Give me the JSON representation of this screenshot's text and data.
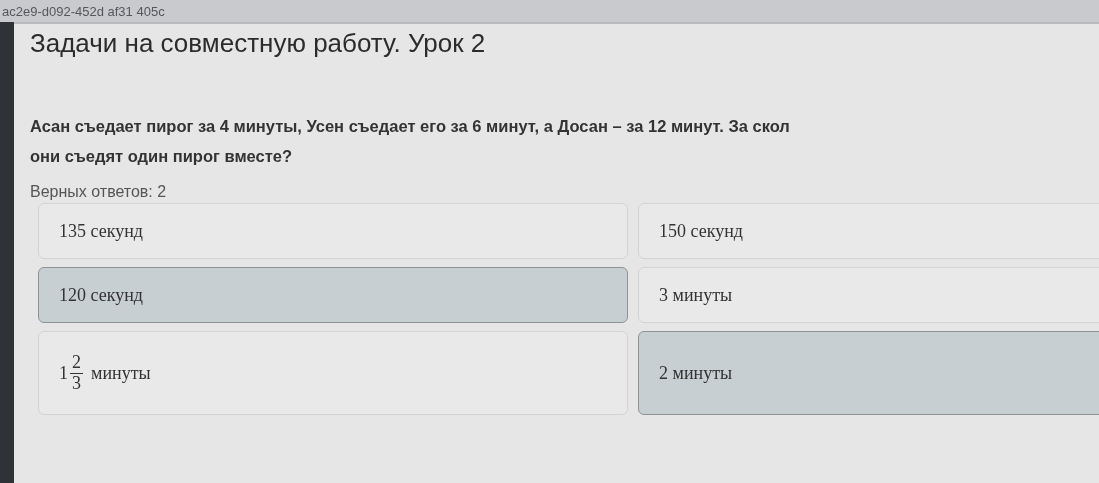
{
  "top_strip": {
    "text": "ac2e9-d092-452d af31 405c"
  },
  "lesson": {
    "title": "Задачи на совместную работу. Урок 2"
  },
  "question": {
    "lines": [
      "Асан съедает пирог за 4 минуты, Усен съедает его за 6 минут, а Досан – за 12 минут. За скол",
      "они съедят один пирог вместе?"
    ]
  },
  "answers_hint": "Верных ответов: 2",
  "options": [
    {
      "kind": "text",
      "text": "135 секунд",
      "selected": false
    },
    {
      "kind": "text",
      "text": "150 секунд",
      "selected": false
    },
    {
      "kind": "text",
      "text": "120 секунд",
      "selected": true
    },
    {
      "kind": "text",
      "text": "3 минуты",
      "selected": false
    },
    {
      "kind": "fraction",
      "whole": "1",
      "numerator": "2",
      "denominator": "3",
      "unit": "минуты",
      "selected": false
    },
    {
      "kind": "text",
      "text": "2 минуты",
      "selected": true
    }
  ]
}
